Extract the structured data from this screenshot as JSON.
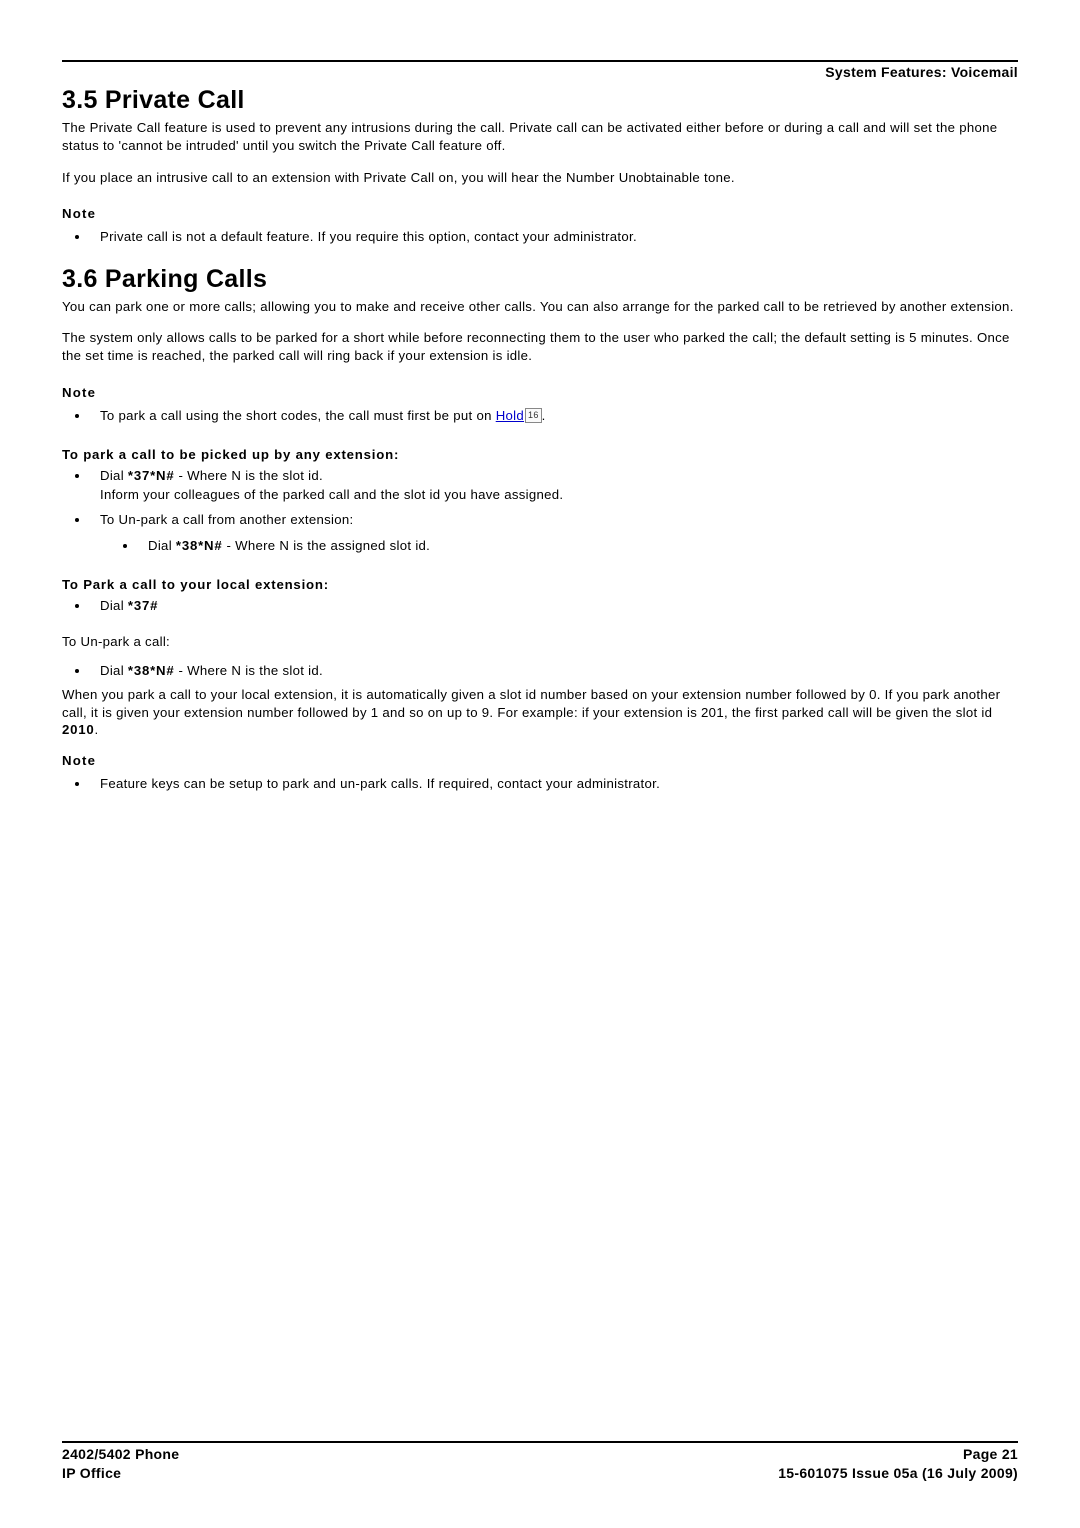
{
  "header": {
    "right": "System Features: Voicemail"
  },
  "s35": {
    "title": "3.5 Private Call",
    "p1": "The Private Call feature is used to prevent any intrusions during the call. Private call can be activated either before or during a call and will set the phone status to 'cannot be intruded' until you switch the Private Call feature off.",
    "p2": "If you place an intrusive call to an extension with Private Call on, you will hear the Number Unobtainable tone.",
    "note_label": "Note",
    "note1": "Private call is not a default feature. If you require this option, contact your administrator."
  },
  "s36": {
    "title": "3.6 Parking Calls",
    "p1": "You can park one or more calls; allowing you to make and receive other calls. You can also arrange for the parked call to be retrieved by another extension.",
    "p2": "The system only allows calls to be parked for a short while before reconnecting them to the user who parked the call; the default setting is 5 minutes. Once the set time is reached, the parked call will ring back if your extension is idle.",
    "note_label": "Note",
    "hold_pre": "To park a call using the short codes, the call must first be put on ",
    "hold_link": "Hold",
    "hold_ref": "16",
    "hold_post": ".",
    "h_any": "To park a call to be picked up by any extension:",
    "any_dial_pre": "Dial ",
    "any_dial_code": "*37*N#",
    "any_dial_post": "  -  Where N is the slot id.",
    "any_inform": "Inform your colleagues of the parked call and the slot id you have assigned.",
    "any_unpark": "To Un-park a call from another extension:",
    "any_unpark_dial_pre": "Dial ",
    "any_unpark_dial_code": "*38*N#",
    "any_unpark_dial_post": "  -  Where N is the assigned slot id.",
    "h_local": "To Park a call to your local extension:",
    "local_dial_pre": "Dial ",
    "local_dial_code": "*37#",
    "h_unpark": "To Un-park a call:",
    "unpark_dial_pre": "Dial ",
    "unpark_dial_code": "*38*N#",
    "unpark_dial_post": "  -  Where N is the slot id.",
    "local_explain_pre": "When you park a call to your local extension, it is automatically given a slot id number based on your extension number followed by 0. If you park another call, it is given your extension number followed by 1 and so on up to 9. For example: if your extension is 201, the first parked call will be given the slot id ",
    "local_explain_code": "2010",
    "local_explain_post": ".",
    "note2_label": "Note",
    "note2": "Feature keys can be setup to park and un-park calls. If required, contact your administrator."
  },
  "footer": {
    "left1": "2402/5402 Phone",
    "left2": "IP Office",
    "right1": "Page 21",
    "right2": "15-601075 Issue 05a (16 July 2009)"
  }
}
